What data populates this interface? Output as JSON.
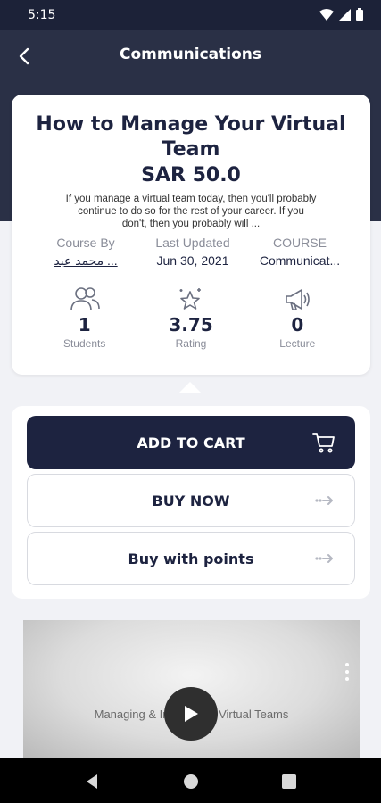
{
  "status_bar": {
    "time": "5:15",
    "icons": [
      "wifi-icon",
      "signal-icon",
      "battery-icon"
    ]
  },
  "app_bar": {
    "title": "Communications",
    "back_icon": "chevron-left-icon"
  },
  "course": {
    "title": "How to Manage Your Virtual Team",
    "price": "SAR 50.0",
    "description": "If you manage a virtual team today, then you'll probably continue to do so for the rest of your career. If you don't, then you probably will ...",
    "meta": [
      {
        "label": "Course By",
        "value": "محمد عبد ..."
      },
      {
        "label": "Last Updated",
        "value": "Jun 30, 2021"
      },
      {
        "label": "COURSE",
        "value": "Communicat..."
      }
    ],
    "stats": [
      {
        "icon": "students-icon",
        "value": "1",
        "label": "Students"
      },
      {
        "icon": "rating-star-icon",
        "value": "3.75",
        "label": "Rating"
      },
      {
        "icon": "megaphone-icon",
        "value": "0",
        "label": "Lecture"
      }
    ]
  },
  "actions": {
    "add_to_cart": "ADD TO CART",
    "buy_now": "BUY NOW",
    "buy_with_points": "Buy with points"
  },
  "video": {
    "title": "Managing & Influencing Virtual Teams"
  },
  "colors": {
    "header": "#2a3046",
    "primary": "#1d2340",
    "background": "#f1f2f6"
  }
}
